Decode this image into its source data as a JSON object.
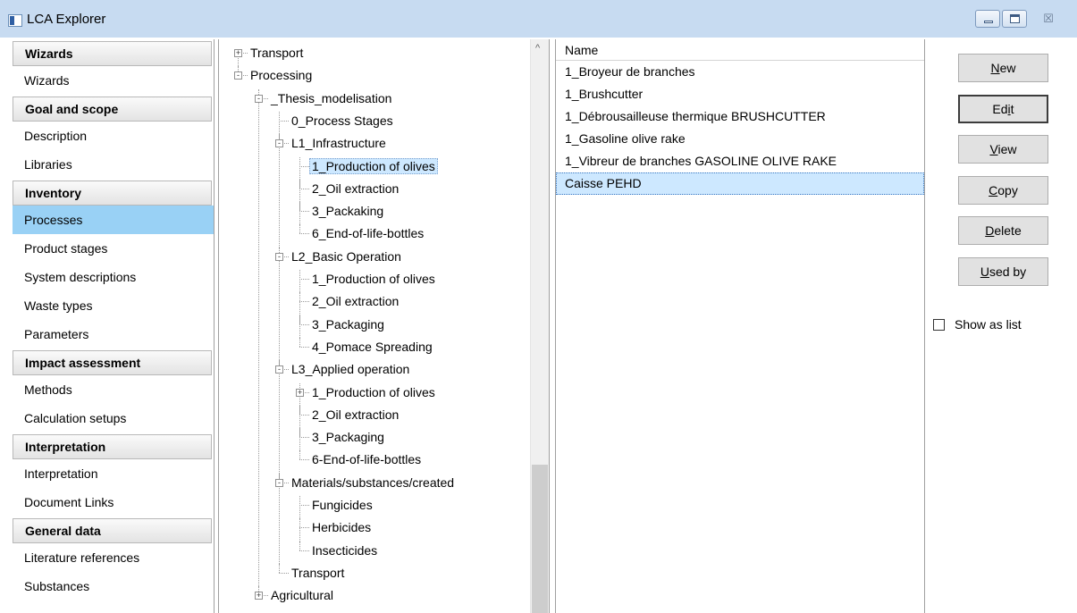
{
  "window": {
    "title": "LCA Explorer",
    "close_glyph": "☒"
  },
  "nav": {
    "sections": [
      {
        "header": "Wizards",
        "items": [
          "Wizards"
        ]
      },
      {
        "header": "Goal and scope",
        "items": [
          "Description",
          "Libraries"
        ]
      },
      {
        "header": "Inventory",
        "items": [
          "Processes",
          "Product stages",
          "System descriptions",
          "Waste types",
          "Parameters"
        ]
      },
      {
        "header": "Impact assessment",
        "items": [
          "Methods",
          "Calculation setups"
        ]
      },
      {
        "header": "Interpretation",
        "items": [
          "Interpretation",
          "Document Links"
        ]
      },
      {
        "header": "General data",
        "items": [
          "Literature references",
          "Substances"
        ]
      }
    ],
    "selected_item": "Processes",
    "selected_color": "#99d1f5"
  },
  "tree": {
    "nodes": [
      {
        "label": "Transport",
        "level": 1,
        "toggle": "+"
      },
      {
        "label": "Processing",
        "level": 1,
        "toggle": "-"
      },
      {
        "label": "_Thesis_modelisation",
        "level": 2,
        "toggle": "-"
      },
      {
        "label": "0_Process Stages",
        "level": 3,
        "toggle": ""
      },
      {
        "label": "L1_Infrastructure",
        "level": 3,
        "toggle": "-"
      },
      {
        "label": "1_Production of olives",
        "level": 4,
        "toggle": "",
        "selected": true
      },
      {
        "label": "2_Oil extraction",
        "level": 4,
        "toggle": ""
      },
      {
        "label": "3_Packaking",
        "level": 4,
        "toggle": ""
      },
      {
        "label": "6_End-of-life-bottles",
        "level": 4,
        "toggle": ""
      },
      {
        "label": "L2_Basic Operation",
        "level": 3,
        "toggle": "-"
      },
      {
        "label": "1_Production of olives",
        "level": 4,
        "toggle": ""
      },
      {
        "label": "2_Oil extraction",
        "level": 4,
        "toggle": ""
      },
      {
        "label": "3_Packaging",
        "level": 4,
        "toggle": ""
      },
      {
        "label": "4_Pomace Spreading",
        "level": 4,
        "toggle": ""
      },
      {
        "label": "L3_Applied operation",
        "level": 3,
        "toggle": "-"
      },
      {
        "label": "1_Production of olives",
        "level": 4,
        "toggle": "+"
      },
      {
        "label": "2_Oil extraction",
        "level": 4,
        "toggle": ""
      },
      {
        "label": "3_Packaging",
        "level": 4,
        "toggle": ""
      },
      {
        "label": "6-End-of-life-bottles",
        "level": 4,
        "toggle": ""
      },
      {
        "label": "Materials/substances/created",
        "level": 3,
        "toggle": "-"
      },
      {
        "label": "Fungicides",
        "level": 4,
        "toggle": ""
      },
      {
        "label": "Herbicides",
        "level": 4,
        "toggle": ""
      },
      {
        "label": "Insecticides",
        "level": 4,
        "toggle": ""
      },
      {
        "label": "Transport",
        "level": 3,
        "toggle": ""
      },
      {
        "label": "Agricultural",
        "level": 2,
        "toggle": "+"
      }
    ],
    "selection_color": "#cde8ff"
  },
  "list": {
    "column_header": "Name",
    "rows": [
      "1_Broyeur de branches",
      "1_Brushcutter",
      "1_Débrousailleuse thermique BRUSHCUTTER",
      "1_Gasoline olive rake",
      "1_Vibreur de branches GASOLINE OLIVE RAKE",
      "Caisse PEHD"
    ],
    "selected_row": "Caisse PEHD"
  },
  "actions": {
    "buttons": [
      {
        "label": "New",
        "mnemonic": "N",
        "name": "new-button"
      },
      {
        "label": "Edit",
        "mnemonic": "i",
        "name": "edit-button",
        "focused": true
      },
      {
        "label": "View",
        "mnemonic": "V",
        "name": "view-button"
      },
      {
        "label": "Copy",
        "mnemonic": "C",
        "name": "copy-button"
      },
      {
        "label": "Delete",
        "mnemonic": "D",
        "name": "delete-button"
      },
      {
        "label": "Used by",
        "mnemonic": "U",
        "name": "used-by-button"
      }
    ],
    "show_as_list_label": "Show as list",
    "show_as_list_checked": false
  }
}
